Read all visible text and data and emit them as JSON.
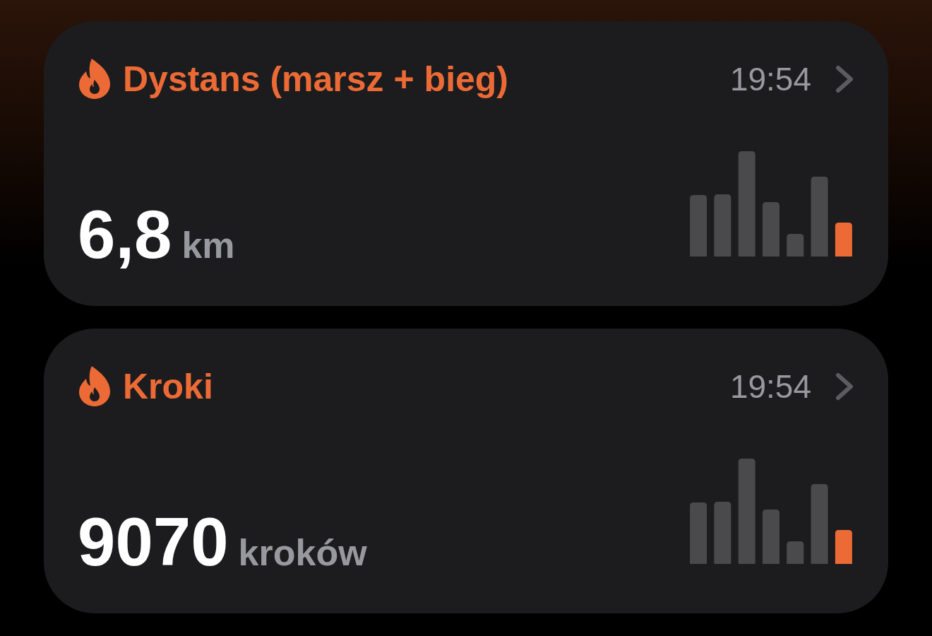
{
  "cards": [
    {
      "title": "Dystans (marsz + bieg)",
      "time": "19:54",
      "value": "6,8",
      "unit": "km"
    },
    {
      "title": "Kroki",
      "time": "19:54",
      "value": "9070",
      "unit": "kroków"
    }
  ]
}
